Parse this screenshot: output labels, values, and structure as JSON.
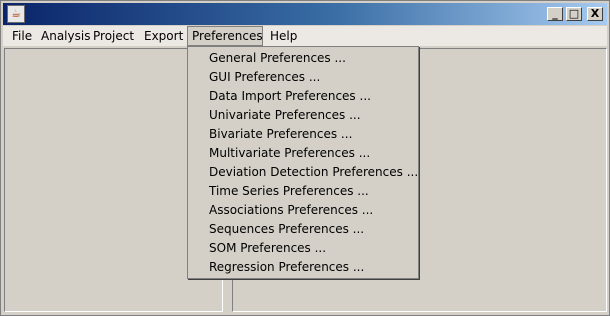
{
  "window": {
    "controls": {
      "minimize": "_",
      "maximize": "□",
      "close": "X"
    },
    "icon": "java-cup-icon"
  },
  "menubar": {
    "items": [
      "File",
      "Analysis",
      "Project",
      "Export",
      "Preferences",
      "Help"
    ],
    "active": "Preferences"
  },
  "preferences_menu": {
    "items": [
      "General Preferences ...",
      "GUI Preferences ...",
      "Data Import Preferences ...",
      "Univariate Preferences ...",
      "Bivariate Preferences ...",
      "Multivariate Preferences ...",
      "Deviation Detection Preferences ...",
      "Time Series Preferences ...",
      "Associations Preferences ...",
      "Sequences Preferences ...",
      "SOM Preferences ...",
      "Regression Preferences ..."
    ]
  }
}
